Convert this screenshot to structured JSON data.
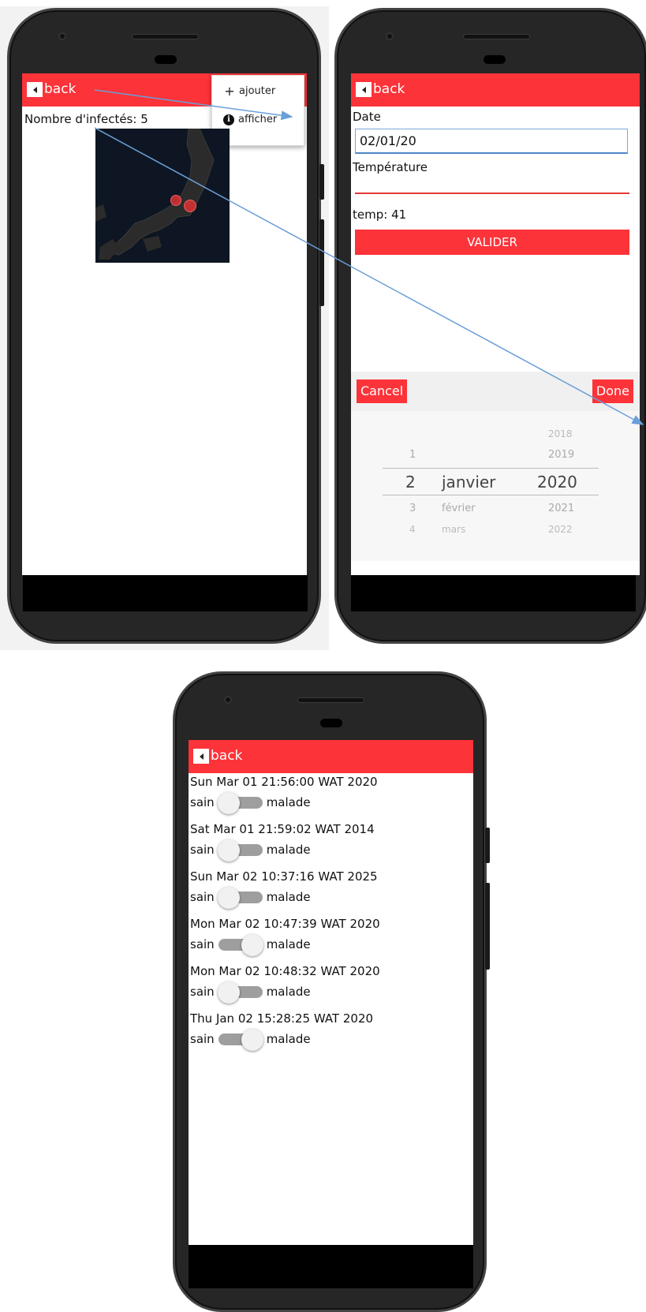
{
  "common": {
    "back_label": "back"
  },
  "screen1": {
    "menu": {
      "add_label": "ajouter",
      "show_label": "afficher"
    },
    "infected_text": "Nombre d'infectés: 5"
  },
  "screen2": {
    "date_label": "Date",
    "date_value": "02/01/20",
    "temp_label": "Température",
    "temp_value": "",
    "temp_readout": "temp: 41",
    "validate_label": "VALIDER",
    "picker": {
      "cancel_label": "Cancel",
      "done_label": "Done",
      "day_above": "1",
      "day_selected": "2",
      "day_below1": "3",
      "day_below2": "4",
      "month_selected": "janvier",
      "month_below1": "février",
      "month_below2": "mars",
      "year_above2": "2018",
      "year_above1": "2019",
      "year_selected": "2020",
      "year_below1": "2021",
      "year_below2": "2022"
    }
  },
  "screen3": {
    "left_label": "sain",
    "right_label": "malade",
    "entries": [
      {
        "date": "Sun Mar 01 21:56:00 WAT 2020",
        "malade": false
      },
      {
        "date": "Sat Mar 01 21:59:02 WAT 2014",
        "malade": false
      },
      {
        "date": "Sun Mar 02 10:37:16 WAT 2025",
        "malade": false
      },
      {
        "date": "Mon Mar 02 10:47:39 WAT 2020",
        "malade": true
      },
      {
        "date": "Mon Mar 02 10:48:32 WAT 2020",
        "malade": false
      },
      {
        "date": "Thu Jan 02 15:28:25 WAT 2020",
        "malade": true
      }
    ]
  },
  "colors": {
    "accent": "#fc3339",
    "arrow": "#6a9fd8"
  }
}
